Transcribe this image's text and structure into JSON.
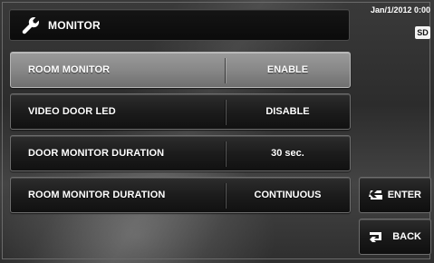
{
  "header": {
    "title": "MONITOR",
    "icon": "wrench-icon"
  },
  "status": {
    "datetime": "Jan/1/2012 0:00",
    "sd": "SD"
  },
  "settings": [
    {
      "label": "ROOM MONITOR",
      "value": "ENABLE",
      "style": "light"
    },
    {
      "label": "VIDEO DOOR LED",
      "value": "DISABLE",
      "style": "dark"
    },
    {
      "label": "DOOR MONITOR DURATION",
      "value": "30 sec.",
      "style": "dark"
    },
    {
      "label": "ROOM MONITOR DURATION",
      "value": "CONTINUOUS",
      "style": "dark"
    }
  ],
  "buttons": {
    "enter": {
      "label": "ENTER",
      "icon": "enter-arrow-icon"
    },
    "back": {
      "label": "BACK",
      "icon": "back-arrow-icon"
    }
  },
  "colors": {
    "text": "#ffffff",
    "selected_row": "#8a8a8a",
    "row": "#1c1c1c"
  }
}
